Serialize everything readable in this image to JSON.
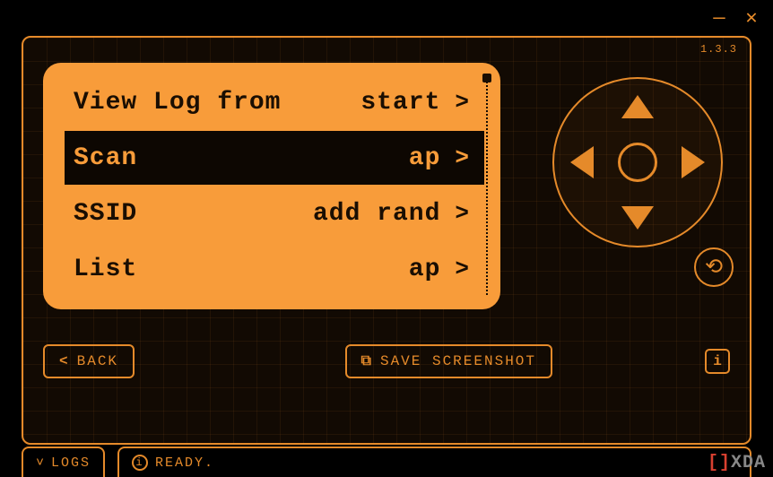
{
  "titlebar": {
    "minimize_glyph": "—",
    "close_glyph": "✕"
  },
  "version": "1.3.3",
  "menu": {
    "items": [
      {
        "label": "View Log from",
        "value": "start",
        "selected": false
      },
      {
        "label": "Scan",
        "value": "ap",
        "selected": true
      },
      {
        "label": "SSID",
        "value": "add rand",
        "selected": false
      },
      {
        "label": "List",
        "value": "ap",
        "selected": false
      }
    ],
    "chevron": ">"
  },
  "dpad": {
    "has_up": true,
    "has_down": true,
    "has_left": true,
    "has_right": true,
    "has_center": true
  },
  "undo": {
    "glyph": "⟲"
  },
  "buttons": {
    "back_icon": "<",
    "back_label": "BACK",
    "save_icon": "⧉",
    "save_label": "SAVE SCREENSHOT",
    "info_glyph": "i"
  },
  "bottom": {
    "logs_icon": "˅",
    "logs_label": "LOGS",
    "status_icon": "i",
    "status_text": "READY."
  },
  "watermark": {
    "bracket": "[]",
    "text": "XDA"
  },
  "colors": {
    "accent": "#e58a2a",
    "screen": "#f89c3a",
    "dark": "#0d0702"
  }
}
